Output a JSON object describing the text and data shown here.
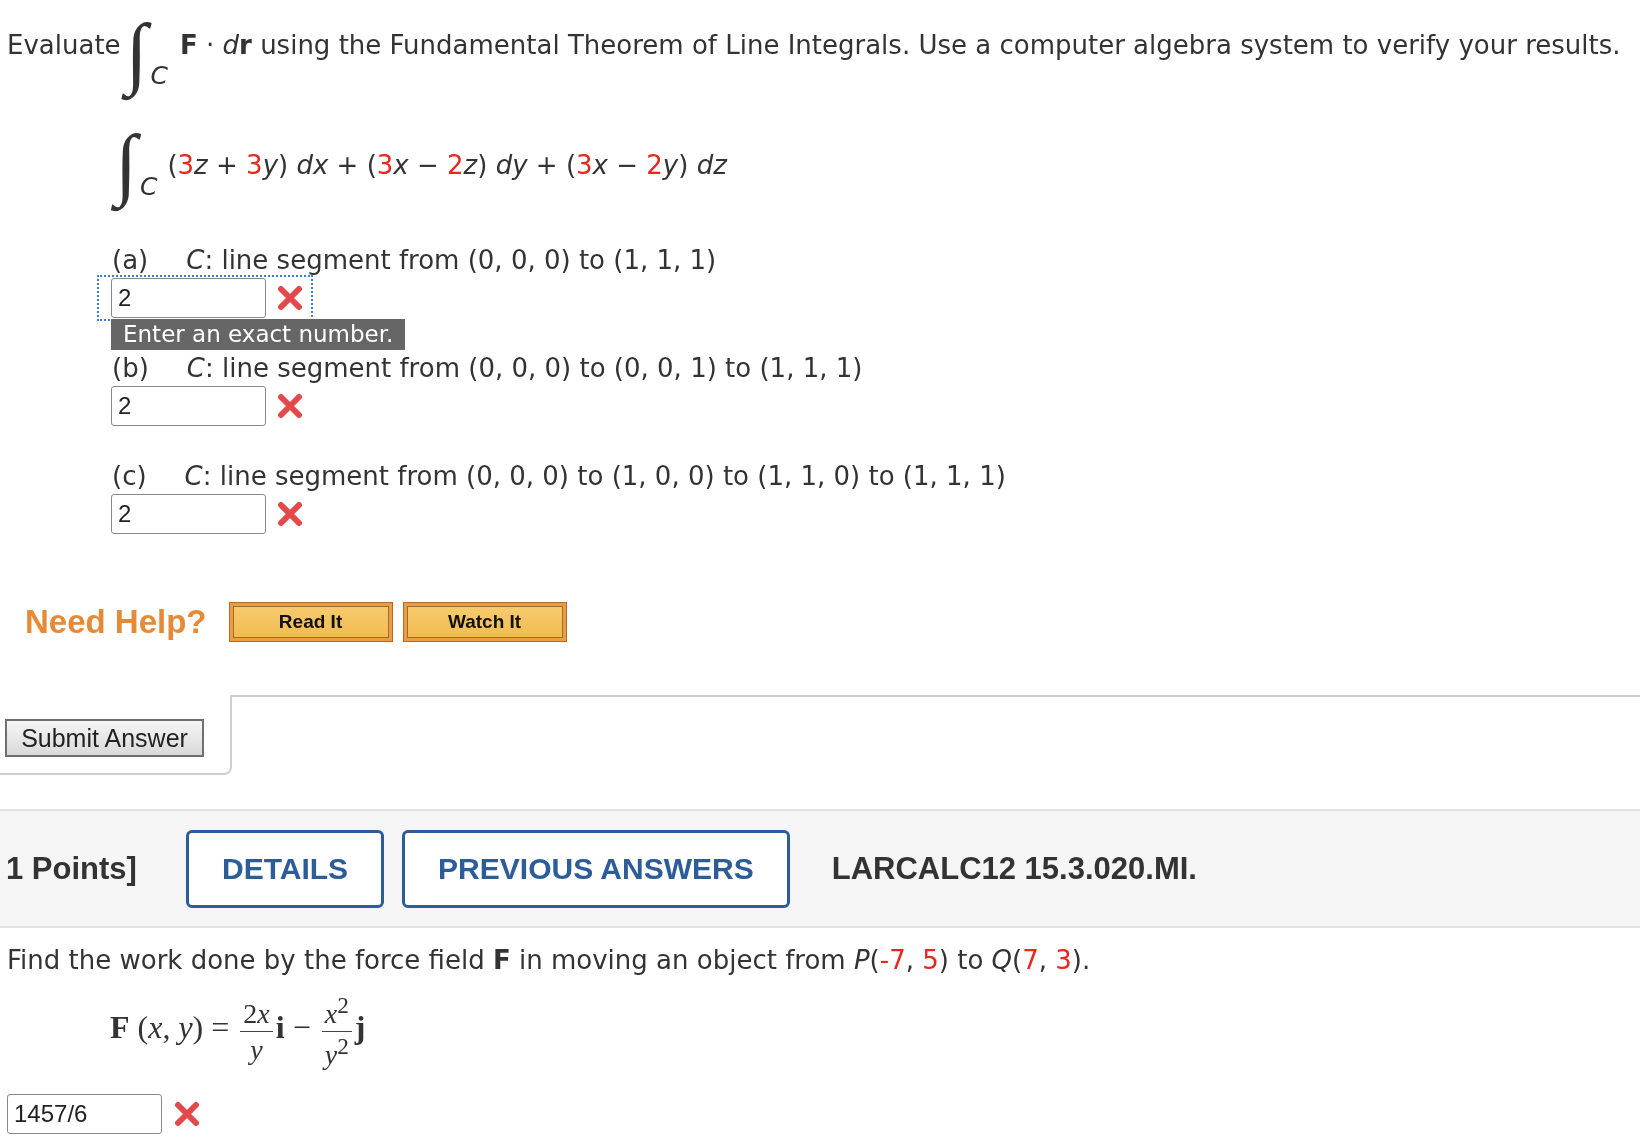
{
  "statement": {
    "lead": "Evaluate",
    "integral": {
      "sign": "∫",
      "subscript": "C"
    },
    "segments": [
      {
        "kind": "text",
        "text": "**F** · *d*"
      },
      {
        "kind": "text",
        "text": "**r** using the Fundamental Theorem of Line Integrals. Use a computer algebra system to verify your results."
      }
    ]
  },
  "integrand": {
    "integral": {
      "sign": "∫",
      "subscript": "C"
    },
    "segments": [
      {
        "kind": "text",
        "text": "("
      },
      {
        "kind": "num",
        "text": "3"
      },
      {
        "kind": "text",
        "text": "*z* + "
      },
      {
        "kind": "num",
        "text": "3"
      },
      {
        "kind": "text",
        "text": "*y*) *dx* + ("
      },
      {
        "kind": "num",
        "text": "3"
      },
      {
        "kind": "text",
        "text": "*x* − "
      },
      {
        "kind": "num",
        "text": "2"
      },
      {
        "kind": "text",
        "text": "*z*) *dy* + ("
      },
      {
        "kind": "num",
        "text": "3"
      },
      {
        "kind": "text",
        "text": "*x* − "
      },
      {
        "kind": "num",
        "text": "2"
      },
      {
        "kind": "text",
        "text": "*y*) *dz*"
      }
    ]
  },
  "parts": [
    {
      "label": "(a)",
      "description": "*C*: line segment from (0, 0, 0) to (1, 1, 1)",
      "answer": "2",
      "correct": false,
      "focused": true,
      "tooltip": "Enter an exact number."
    },
    {
      "label": "(b)",
      "description": "*C*: line segment from (0, 0, 0) to (0, 0, 1) to (1, 1, 1)",
      "answer": "2",
      "correct": false,
      "focused": false
    },
    {
      "label": "(c)",
      "description": "*C*: line segment from (0, 0, 0) to (1, 0, 0) to (1, 1, 0) to (1, 1, 1)",
      "answer": "2",
      "correct": false,
      "focused": false
    }
  ],
  "help": {
    "title": "Need Help?",
    "buttons": [
      "Read It",
      "Watch It"
    ]
  },
  "submit_button": "Submit Answer",
  "header": {
    "points": "1 Points]",
    "buttons": [
      "DETAILS",
      "PREVIOUS ANSWERS"
    ],
    "question_id": "LARCALC12 15.3.020.MI."
  },
  "question": {
    "segments": [
      {
        "kind": "text",
        "text": "Find the work done by the force field **F** in moving an object from *P*("
      },
      {
        "kind": "num",
        "text": "-7"
      },
      {
        "kind": "text",
        "text": ", "
      },
      {
        "kind": "num",
        "text": "5"
      },
      {
        "kind": "text",
        "text": ") to *Q*("
      },
      {
        "kind": "num",
        "text": "7"
      },
      {
        "kind": "text",
        "text": ", "
      },
      {
        "kind": "num",
        "text": "3"
      },
      {
        "kind": "text",
        "text": ")."
      }
    ],
    "formula": [
      {
        "kind": "bold",
        "text": "F"
      },
      {
        "kind": "text",
        "text": " (*x*, *y*) = "
      },
      {
        "kind": "frac",
        "num": [
          "2",
          "*x*"
        ],
        "den": [
          "*y*"
        ]
      },
      {
        "kind": "bold",
        "text": "i"
      },
      {
        "kind": "text",
        "text": " − "
      },
      {
        "kind": "frac",
        "num": [
          "*x*$^{2}$"
        ],
        "den": [
          "*y*$^{2}$"
        ]
      },
      {
        "kind": "bold",
        "text": "j"
      }
    ],
    "answer": "1457/6",
    "correct": false
  }
}
